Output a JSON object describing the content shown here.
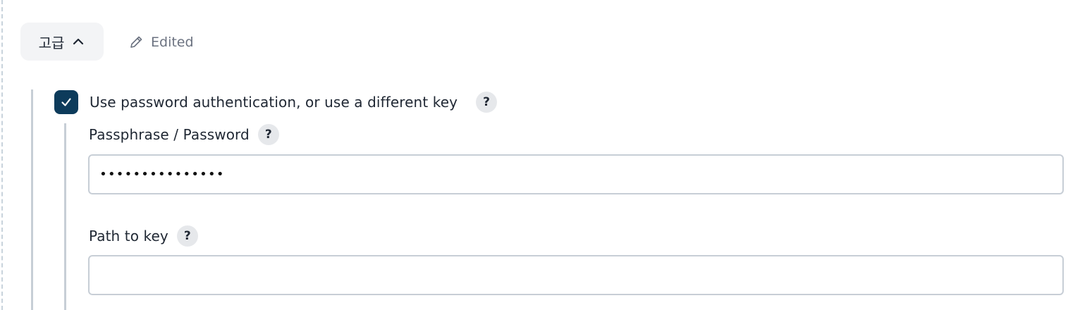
{
  "advanced": {
    "label": "고급",
    "edited_label": "Edited"
  },
  "options": {
    "use_password_label": "Use password authentication, or use a different key",
    "use_password_checked": true,
    "help_mark": "?"
  },
  "fields": {
    "passphrase": {
      "label": "Passphrase / Password",
      "value": "•••••••••••••••"
    },
    "path_to_key": {
      "label": "Path to key",
      "value": ""
    }
  },
  "colors": {
    "checkbox": "#0d3b5b",
    "border": "#c7ced6",
    "muted_text": "#6b7280"
  }
}
